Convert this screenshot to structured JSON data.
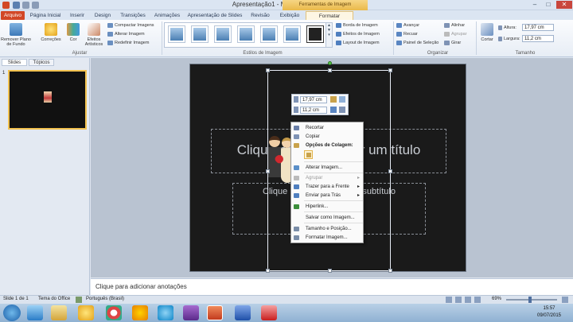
{
  "window": {
    "title": "Apresentação1 - Microsoft PowerPoint",
    "context_title": "Ferramentas de Imagem",
    "controls": [
      "–",
      "□",
      "✕"
    ]
  },
  "tabs": [
    {
      "label": "Arquivo",
      "active": false
    },
    {
      "label": "Página Inicial"
    },
    {
      "label": "Inserir"
    },
    {
      "label": "Design"
    },
    {
      "label": "Transições"
    },
    {
      "label": "Animações"
    },
    {
      "label": "Apresentação de Slides"
    },
    {
      "label": "Revisão"
    },
    {
      "label": "Exibição"
    },
    {
      "label": "Formatar",
      "active": true
    }
  ],
  "ribbon": {
    "ajustar": {
      "label": "Ajustar",
      "remove_bg": "Remover Plano de Fundo",
      "corrections": "Correções",
      "color": "Cor",
      "artistic": "Efeitos Artísticos",
      "compress": "Compactar Imagens",
      "change": "Alterar Imagem",
      "reset": "Redefinir Imagem"
    },
    "estilos": {
      "label": "Estilos de Imagem",
      "border": "Borda de Imagem",
      "effects": "Efeitos de Imagem",
      "layout": "Layout de Imagem"
    },
    "organizar": {
      "label": "Organizar",
      "bring_forward": "Avançar",
      "send_backward": "Recuar",
      "selection_pane": "Painel de Seleção",
      "align": "Alinhar",
      "group": "Agrupar",
      "rotate": "Girar"
    },
    "tamanho": {
      "label": "Tamanho",
      "crop": "Cortar",
      "height_label": "Altura:",
      "height": "17,97 cm",
      "width_label": "Largura:",
      "width": "11,2 cm"
    }
  },
  "panel": {
    "tab_slides": "Slides",
    "tab_outline": "Tópicos",
    "slide_number": "1"
  },
  "slide": {
    "title_placeholder": "Clique para adicionar um título",
    "subtitle_placeholder": "Clique para adicionar um subtítulo"
  },
  "mini_toolbar": {
    "height": "17,97 cm",
    "width": "11,2 cm"
  },
  "context_menu": [
    {
      "label": "Recortar",
      "enabled": true,
      "icon": "scissors-icon",
      "color": "#6a7fa8"
    },
    {
      "label": "Copiar",
      "enabled": true,
      "icon": "copy-icon",
      "color": "#7f93b5"
    },
    {
      "label": "Opções de Colagem:",
      "enabled": true,
      "bold": true,
      "icon": "paste-icon",
      "color": "#c9a24b"
    },
    {
      "label": "Alterar Imagem...",
      "enabled": true,
      "icon": "picture-icon",
      "color": "#5a8fc8"
    },
    {
      "label": "Agrupar",
      "enabled": false,
      "submenu": true,
      "icon": "group-icon",
      "color": "#bbbbbb"
    },
    {
      "label": "Trazer para a Frente",
      "enabled": true,
      "submenu": true,
      "icon": "bring-front-icon",
      "color": "#4f7fbf"
    },
    {
      "label": "Enviar para Trás",
      "enabled": true,
      "submenu": true,
      "icon": "send-back-icon",
      "color": "#4f7fbf"
    },
    {
      "label": "Hiperlink...",
      "enabled": true,
      "icon": "hyperlink-icon",
      "color": "#3c8f3c"
    },
    {
      "label": "Salvar como Imagem...",
      "enabled": true,
      "icon": "",
      "color": ""
    },
    {
      "label": "Tamanho e Posição...",
      "enabled": true,
      "icon": "size-icon",
      "color": "#7a8da8"
    },
    {
      "label": "Formatar Imagem...",
      "enabled": true,
      "icon": "format-picture-icon",
      "color": "#7a8da8"
    }
  ],
  "notes": {
    "placeholder": "Clique para adicionar anotações"
  },
  "status": {
    "slide": "Slide 1 de 1",
    "theme": "Tema do Office",
    "language": "Português (Brasil)",
    "zoom": "69%"
  },
  "taskbar": {
    "time": "15:57",
    "date": "09/07/2015"
  },
  "colors": {
    "accent": "#d24726",
    "context": "#eab94a",
    "ribbon": "#e7edf5"
  }
}
